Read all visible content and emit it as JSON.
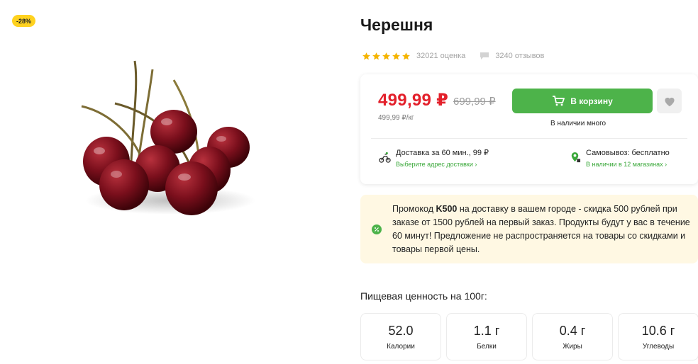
{
  "badge": {
    "discount": "-28%"
  },
  "product": {
    "title": "Черешня",
    "rating_count": "32021 оценка",
    "reviews_count": "3240 отзывов",
    "star_color": "#f5b400",
    "stars": 5
  },
  "price": {
    "current": "499,99 ₽",
    "old": "699,99 ₽",
    "per_kg": "499,99 ₽/кг",
    "color": "#e3202b"
  },
  "actions": {
    "cart_label": "В корзину",
    "cart_color": "#4db34a",
    "availability": "В наличии много"
  },
  "delivery": {
    "title": "Доставка за 60 мин., 99 ₽",
    "link": "Выберите адрес доставки ›"
  },
  "pickup": {
    "title": "Самовывоз: бесплатно",
    "link": "В наличии в 12 магазинах ›"
  },
  "promo": {
    "prefix": "Промокод ",
    "code": "K500",
    "text": " на доставку в вашем городе - скидка 500 рублей при заказе от 1500 рублей на первый заказ. Продукты будут у вас в течение 60 минут! Предложение не распространяется на товары со скидками и товары первой цены.",
    "background": "#fff8e3"
  },
  "nutrition": {
    "title": "Пищевая ценность на 100г:",
    "items": [
      {
        "value": "52.0",
        "label": "Калории"
      },
      {
        "value": "1.1 г",
        "label": "Белки"
      },
      {
        "value": "0.4 г",
        "label": "Жиры"
      },
      {
        "value": "10.6 г",
        "label": "Углеводы"
      }
    ]
  }
}
